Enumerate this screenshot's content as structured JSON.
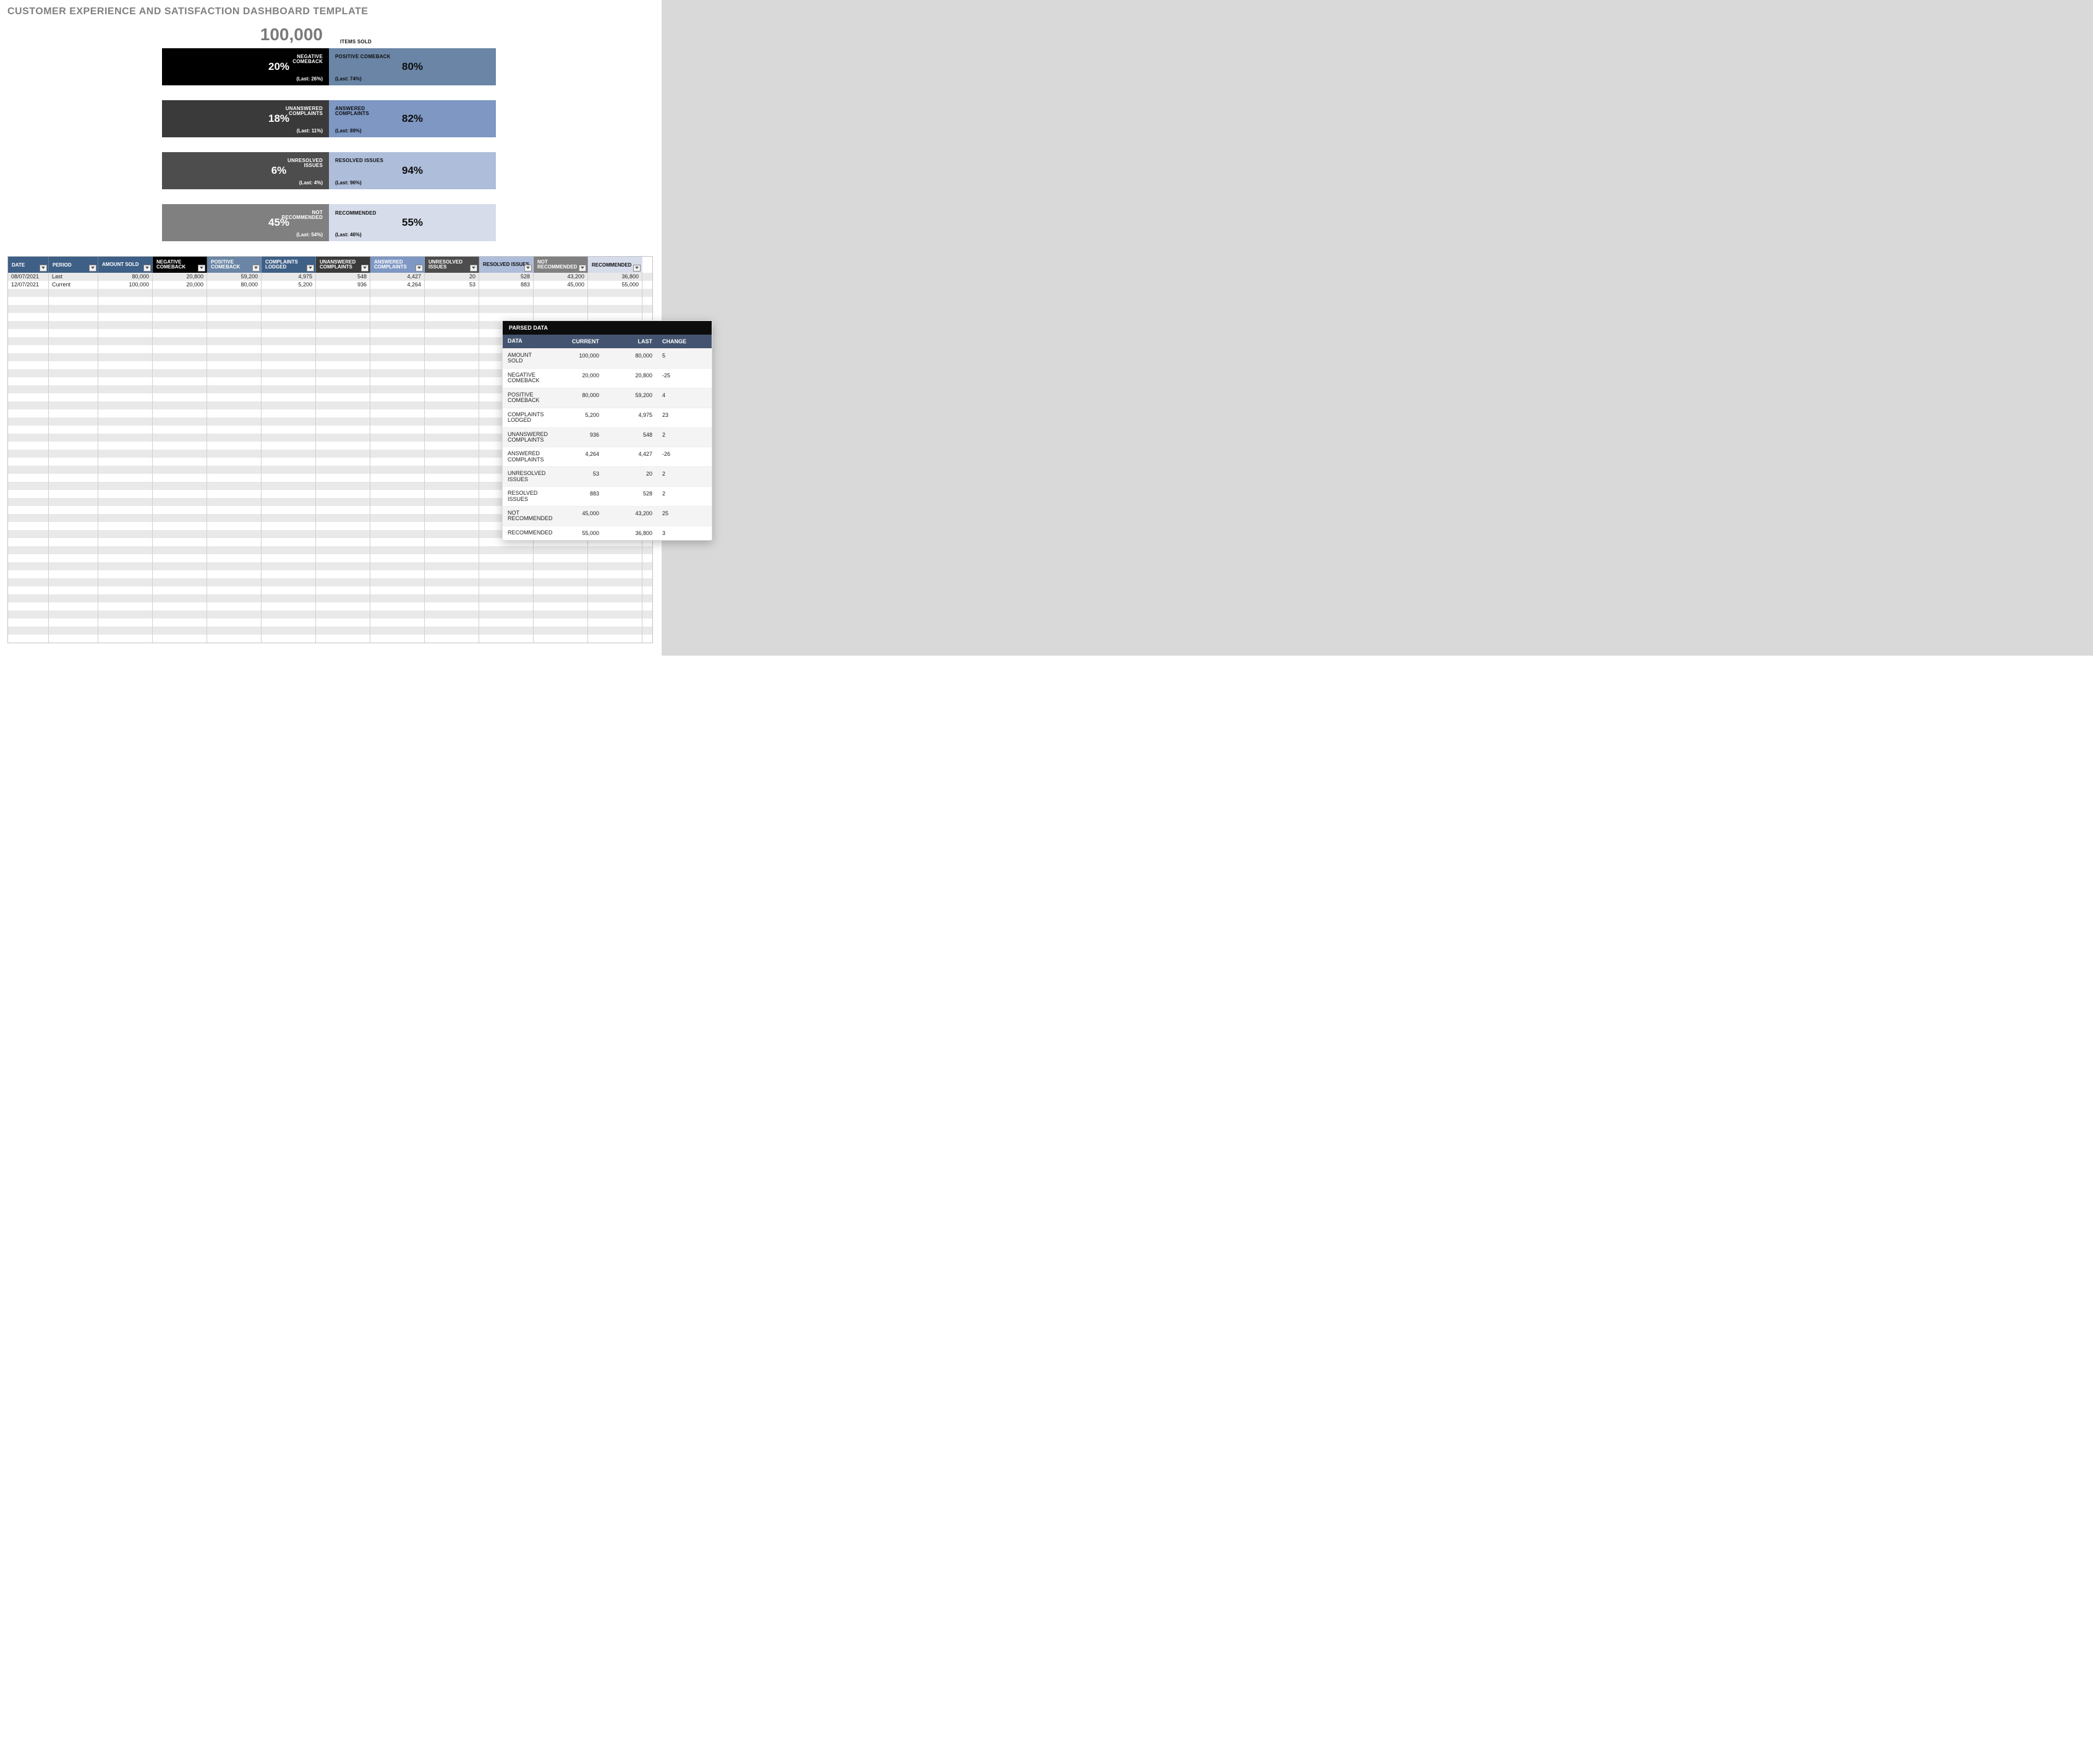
{
  "title": "CUSTOMER EXPERIENCE AND SATISFACTION DASHBOARD TEMPLATE",
  "items_sold": {
    "value": "100,000",
    "label": "ITEMS SOLD"
  },
  "metrics": [
    {
      "left": {
        "pct": "20%",
        "label": "NEGATIVE COMEBACK",
        "last": "(Last: 26%)",
        "bg": "#000000"
      },
      "right": {
        "pct": "80%",
        "label": "POSITIVE COMEBACK",
        "last": "(Last: 74%)",
        "bg": "#6a85a5",
        "dark": true
      }
    },
    {
      "left": {
        "pct": "18%",
        "label": "UNANSWERED COMPLAINTS",
        "last": "(Last: 11%)",
        "bg": "#3a3a3a"
      },
      "right": {
        "pct": "82%",
        "label": "ANSWERED COMPLAINTS",
        "last": "(Last: 89%)",
        "bg": "#7e97c3",
        "dark": true
      }
    },
    {
      "left": {
        "pct": "6%",
        "label": "UNRESOLVED ISSUES",
        "last": "(Last: 4%)",
        "bg": "#4d4d4d"
      },
      "right": {
        "pct": "94%",
        "label": "RESOLVED ISSUES",
        "last": "(Last: 96%)",
        "bg": "#aebdd9",
        "dark": true
      }
    },
    {
      "left": {
        "pct": "45%",
        "label": "NOT RECOMMENDED",
        "last": "(Last: 54%)",
        "bg": "#808080"
      },
      "right": {
        "pct": "55%",
        "label": "RECOMMENDED",
        "last": "(Last: 46%)",
        "bg": "#d6dcea",
        "dark": true
      }
    }
  ],
  "grid": {
    "headers": [
      {
        "label": "DATE",
        "bg": "#3e5f86"
      },
      {
        "label": "PERIOD",
        "bg": "#3e5f86"
      },
      {
        "label": "AMOUNT SOLD",
        "bg": "#3e5f86"
      },
      {
        "label": "NEGATIVE COMEBACK",
        "bg": "#000000"
      },
      {
        "label": "POSITIVE COMEBACK",
        "bg": "#6a85a5"
      },
      {
        "label": "COMPLAINTS LODGED",
        "bg": "#3e5f86"
      },
      {
        "label": "UNANSWERED COMPLAINTS",
        "bg": "#3a3a3a"
      },
      {
        "label": "ANSWERED COMPLAINTS",
        "bg": "#7e97c3"
      },
      {
        "label": "UNRESOLVED ISSUES",
        "bg": "#4d4d4d"
      },
      {
        "label": "RESOLVED ISSUES",
        "bg": "#aebdd9",
        "dark": true
      },
      {
        "label": "NOT RECOMMENDED",
        "bg": "#808080"
      },
      {
        "label": "RECOMMENDED",
        "bg": "#d6dcea",
        "dark": true
      }
    ],
    "rows": [
      [
        "08/07/2021",
        "Last",
        "80,000",
        "20,800",
        "59,200",
        "4,975",
        "548",
        "4,427",
        "20",
        "528",
        "43,200",
        "36,800"
      ],
      [
        "12/07/2021",
        "Current",
        "100,000",
        "20,000",
        "80,000",
        "5,200",
        "936",
        "4,264",
        "53",
        "883",
        "45,000",
        "55,000"
      ]
    ],
    "blank_rows": 44
  },
  "parsed": {
    "title": "PARSED DATA",
    "headers": [
      "DATA",
      "CURRENT",
      "LAST",
      "CHANGE"
    ],
    "rows": [
      [
        "AMOUNT SOLD",
        "100,000",
        "80,000",
        "5"
      ],
      [
        "NEGATIVE COMEBACK",
        "20,000",
        "20,800",
        "-25"
      ],
      [
        "POSITIVE COMEBACK",
        "80,000",
        "59,200",
        "4"
      ],
      [
        "COMPLAINTS LODGED",
        "5,200",
        "4,975",
        "23"
      ],
      [
        "UNANSWERED COMPLAINTS",
        "936",
        "548",
        "2"
      ],
      [
        "ANSWERED COMPLAINTS",
        "4,264",
        "4,427",
        "-26"
      ],
      [
        "UNRESOLVED ISSUES",
        "53",
        "20",
        "2"
      ],
      [
        "RESOLVED ISSUES",
        "883",
        "528",
        "2"
      ],
      [
        "NOT RECOMMENDED",
        "45,000",
        "43,200",
        "25"
      ],
      [
        "RECOMMENDED",
        "55,000",
        "36,800",
        "3"
      ]
    ]
  },
  "chart_data": {
    "type": "table",
    "note": "KPI pair bars with current % and prior (Last) %",
    "series": [
      {
        "name": "NEGATIVE COMEBACK",
        "current_pct": 20,
        "last_pct": 26
      },
      {
        "name": "POSITIVE COMEBACK",
        "current_pct": 80,
        "last_pct": 74
      },
      {
        "name": "UNANSWERED COMPLAINTS",
        "current_pct": 18,
        "last_pct": 11
      },
      {
        "name": "ANSWERED COMPLAINTS",
        "current_pct": 82,
        "last_pct": 89
      },
      {
        "name": "UNRESOLVED ISSUES",
        "current_pct": 6,
        "last_pct": 4
      },
      {
        "name": "RESOLVED ISSUES",
        "current_pct": 94,
        "last_pct": 96
      },
      {
        "name": "NOT RECOMMENDED",
        "current_pct": 45,
        "last_pct": 54
      },
      {
        "name": "RECOMMENDED",
        "current_pct": 55,
        "last_pct": 46
      }
    ]
  }
}
